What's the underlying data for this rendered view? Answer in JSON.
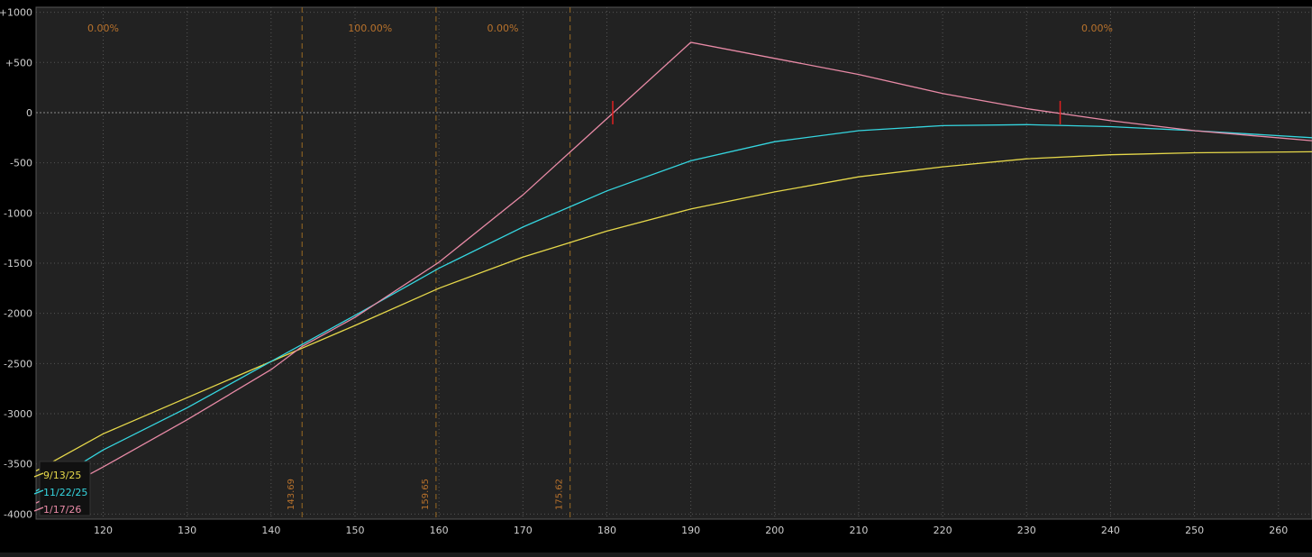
{
  "chart_data": {
    "type": "line",
    "xlim": [
      112,
      264
    ],
    "ylim": [
      -4050,
      1050
    ],
    "x_ticks": [
      120,
      130,
      140,
      150,
      160,
      170,
      180,
      190,
      200,
      210,
      220,
      230,
      240,
      250,
      260
    ],
    "x_tick_labels": [
      "120",
      "130",
      "140",
      "150",
      "160",
      "170",
      "180",
      "190",
      "200",
      "210",
      "220",
      "230",
      "240",
      "250",
      "260"
    ],
    "y_ticks": [
      1000,
      500,
      0,
      -500,
      -1000,
      -1500,
      -2000,
      -2500,
      -3000,
      -3500,
      -4000
    ],
    "y_tick_labels": [
      "+1000",
      "+500",
      "0",
      "-500",
      "-1000",
      "-1500",
      "-2000",
      "-2500",
      "-3000",
      "-3500",
      "-4000"
    ],
    "grid": true,
    "legend_position": "bottom-left",
    "vertical_markers": [
      {
        "x": 143.69,
        "label": "143.69"
      },
      {
        "x": 159.65,
        "label": "159.65"
      },
      {
        "x": 175.62,
        "label": "175.62"
      }
    ],
    "probability_labels": [
      {
        "x": 120,
        "text": "0.00%"
      },
      {
        "x": 151.8,
        "text": "100.00%"
      },
      {
        "x": 167.6,
        "text": "0.00%"
      },
      {
        "x": 238.4,
        "text": "0.00%"
      }
    ],
    "breakeven_points": [
      180.7,
      234
    ],
    "series": [
      {
        "name": "9/13/25",
        "color": "#e6d84a",
        "x": [
          112,
          120,
          130,
          140,
          150,
          160,
          170,
          180,
          190,
          200,
          210,
          220,
          230,
          240,
          250,
          264
        ],
        "y": [
          -3570,
          -3200,
          -2840,
          -2480,
          -2120,
          -1750,
          -1440,
          -1180,
          -960,
          -790,
          -640,
          -540,
          -460,
          -420,
          -400,
          -390
        ]
      },
      {
        "name": "11/22/25",
        "color": "#35d6e0",
        "x": [
          112,
          120,
          130,
          140,
          150,
          160,
          170,
          180,
          190,
          200,
          210,
          220,
          230,
          240,
          250,
          264
        ],
        "y": [
          -3770,
          -3360,
          -2940,
          -2480,
          -2020,
          -1550,
          -1140,
          -780,
          -480,
          -290,
          -180,
          -130,
          -120,
          -140,
          -180,
          -250
        ]
      },
      {
        "name": "1/17/26",
        "color": "#e88aa6",
        "x": [
          112,
          120,
          130,
          140,
          143.69,
          150,
          160,
          170,
          180,
          190,
          200,
          210,
          220,
          230,
          240,
          250,
          264
        ],
        "y": [
          -3890,
          -3530,
          -3060,
          -2560,
          -2330,
          -2040,
          -1490,
          -820,
          -60,
          700,
          540,
          380,
          190,
          40,
          -80,
          -180,
          -280
        ]
      }
    ]
  }
}
